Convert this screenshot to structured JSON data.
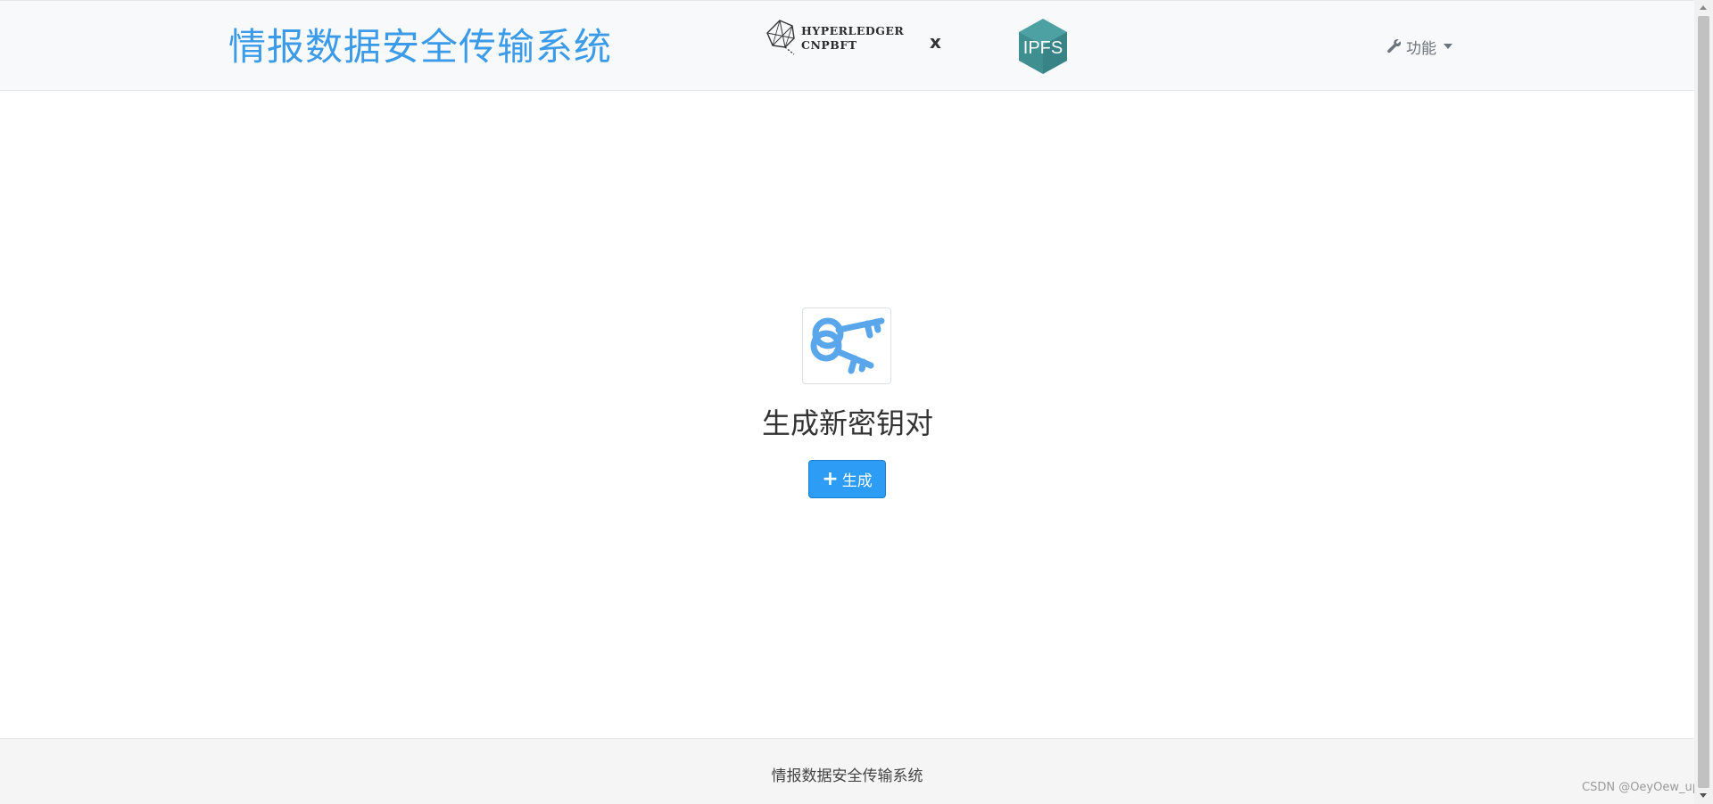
{
  "navbar": {
    "brand_title": "情报数据安全传输系统",
    "hyperledger_line1": "HYPERLEDGER",
    "hyperledger_line2": "CNPBFT",
    "separator": "x",
    "ipfs_label": "IPFS",
    "function_menu_label": "功能"
  },
  "main": {
    "title": "生成新密钥对",
    "generate_button_label": "生成"
  },
  "footer": {
    "text": "情报数据安全传输系统"
  },
  "watermark": "CSDN @OeyOew_up",
  "colors": {
    "brand": "#3b9be8",
    "button": "#2d9cf5",
    "ipfs": "#3f8f91",
    "key_icon": "#5aa6ea"
  },
  "icons": {
    "function_menu": "wrench-icon",
    "generate_button": "plus-icon",
    "key_image": "keys-icon",
    "hyperledger": "hyperledger-logo",
    "ipfs": "ipfs-logo"
  }
}
